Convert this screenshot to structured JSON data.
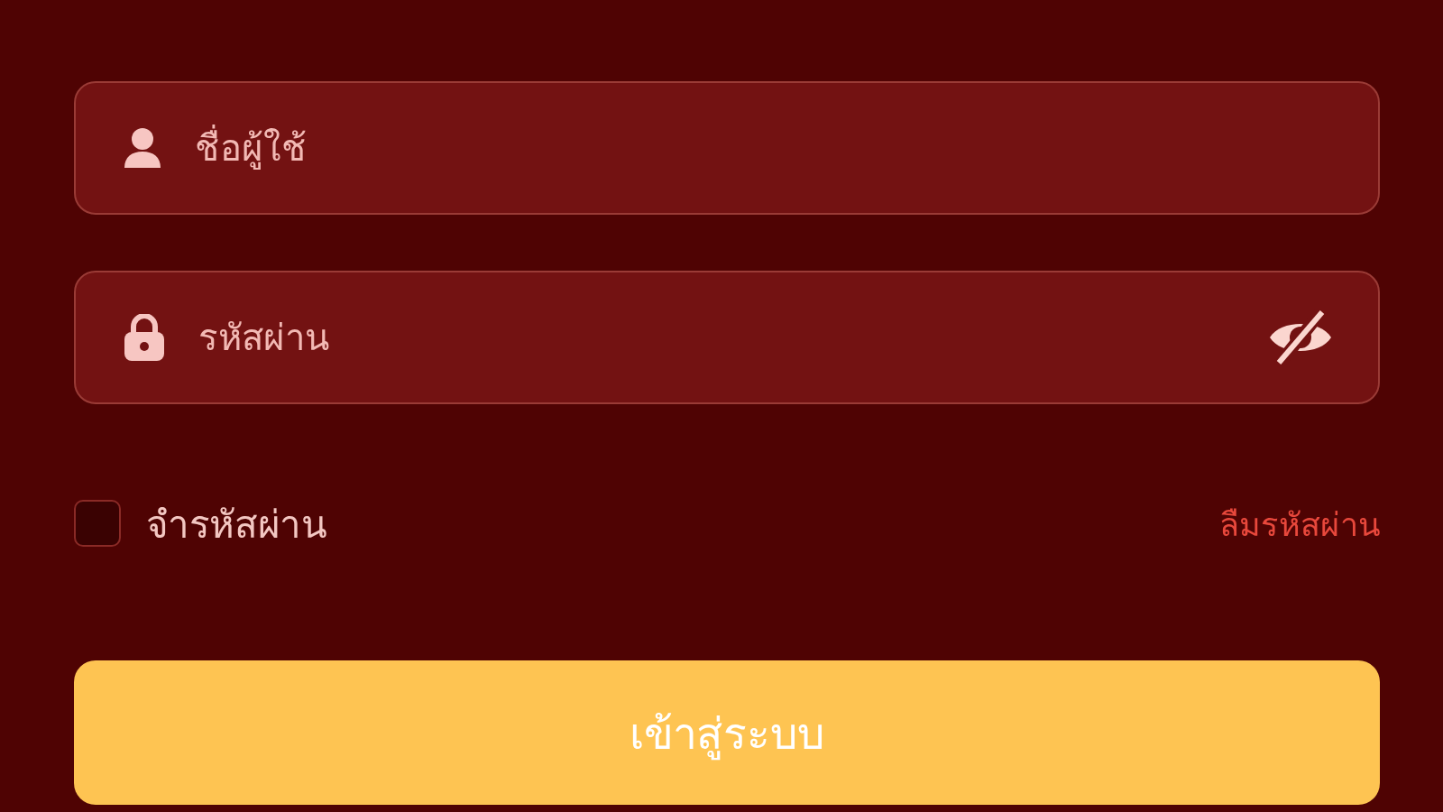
{
  "username_field": {
    "placeholder": "ชื่อผู้ใช้"
  },
  "password_field": {
    "placeholder": "รหัสผ่าน",
    "password_visible": false
  },
  "remember": {
    "label": "จำรหัสผ่าน",
    "checked": false
  },
  "forgot_link": "ลืมรหัสผ่าน",
  "login_button": "เข้าสู่ระบบ"
}
